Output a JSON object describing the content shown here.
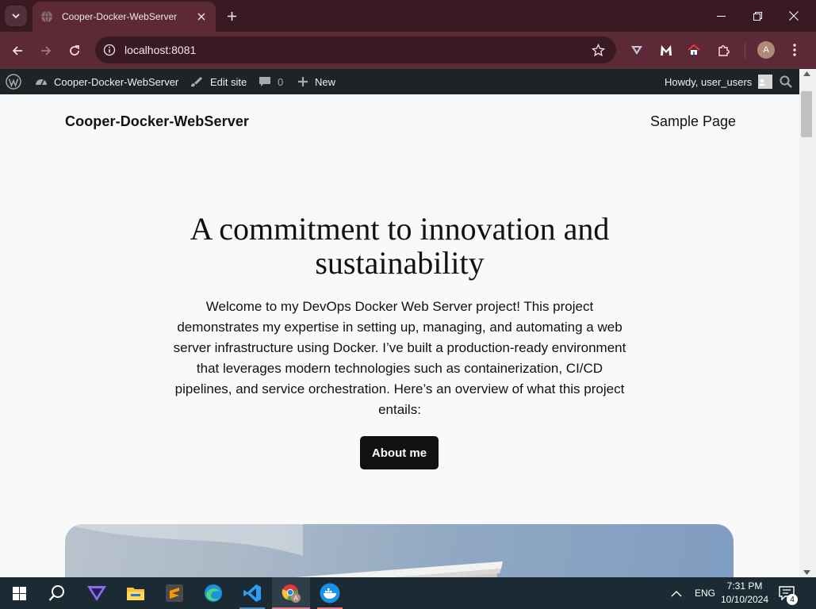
{
  "browser": {
    "tab_title": "Cooper-Docker-WebServer",
    "url": "localhost:8081",
    "profile_initial": "A"
  },
  "adminbar": {
    "site_name": "Cooper-Docker-WebServer",
    "edit_site": "Edit site",
    "comments_count": "0",
    "new_label": "New",
    "howdy": "Howdy, user_users"
  },
  "site": {
    "title": "Cooper-Docker-WebServer",
    "nav_item": "Sample Page"
  },
  "hero": {
    "heading": "A commitment to innovation and sustainability",
    "body": "Welcome to my DevOps Docker Web Server project! This project demonstrates my expertise in setting up, managing, and automating a web server infrastructure using Docker. I’ve built a production-ready environment that leverages modern technologies such as containerization, CI/CD pipelines, and service orchestration. Here’s an overview of what this project entails:",
    "button_label": "About me"
  },
  "taskbar": {
    "language": "ENG",
    "time": "7:31 PM",
    "date": "10/10/2024",
    "notification_count": "4",
    "chrome_badge": "A"
  },
  "icons": [
    "tab-search-icon",
    "globe-icon",
    "close-icon",
    "plus-icon",
    "minimize-icon",
    "restore-icon",
    "back-icon",
    "forward-icon",
    "reload-icon",
    "site-info-icon",
    "star-icon",
    "vpn-extension-icon",
    "malwarebytes-icon",
    "home-extension-icon",
    "extensions-icon",
    "menu-dots-icon",
    "wordpress-icon",
    "dashboard-icon",
    "brush-icon",
    "comment-icon",
    "search-icon",
    "windows-start-icon",
    "taskbar-search-icon",
    "proton-vpn-icon",
    "file-explorer-icon",
    "sublime-text-icon",
    "edge-icon",
    "vscode-icon",
    "chrome-icon",
    "docker-icon",
    "chevron-up-icon",
    "notification-icon"
  ],
  "colors": {
    "chrome_dark": "#3a1a22",
    "chrome_tab": "#5b2a36",
    "admin_bar": "#1d2327",
    "page_bg": "#f9f9f9",
    "button_bg": "#111111",
    "taskbar": "#1b2a33"
  }
}
